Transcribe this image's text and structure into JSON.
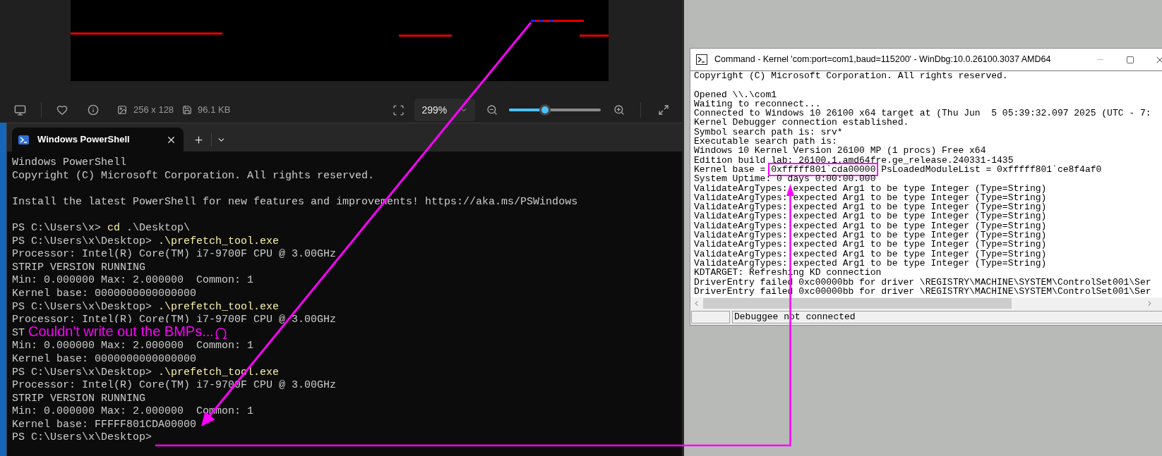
{
  "image_viewer": {
    "toolbar": {
      "dimensions": "256 x 128",
      "file_size": "96.1 KB",
      "zoom": {
        "value": "299%",
        "level": 0.39
      }
    }
  },
  "terminal": {
    "tabs": [
      {
        "title": "Windows PowerShell",
        "selected": true
      }
    ],
    "lines": [
      {
        "kind": "output",
        "text": "Windows PowerShell"
      },
      {
        "kind": "output",
        "text": "Copyright (C) Microsoft Corporation. All rights reserved."
      },
      {
        "kind": "blank"
      },
      {
        "kind": "output",
        "text": "Install the latest PowerShell for new features and improvements! https://aka.ms/PSWindows"
      },
      {
        "kind": "blank"
      },
      {
        "kind": "prompt",
        "prompt": "PS C:\\Users\\x>",
        "command": "cd",
        "args": ".\\Desktop\\"
      },
      {
        "kind": "prompt",
        "prompt": "PS C:\\Users\\x\\Desktop>",
        "command": ".\\prefetch_tool.exe"
      },
      {
        "kind": "output",
        "text": "Processor: Intel(R) Core(TM) i7-9700F CPU @ 3.00GHz"
      },
      {
        "kind": "output",
        "text": "STRIP VERSION RUNNING"
      },
      {
        "kind": "output",
        "text": "Min: 0.000000 Max: 2.000000  Common: 1"
      },
      {
        "kind": "output",
        "text": "Kernel base: 0000000000000000"
      },
      {
        "kind": "prompt",
        "prompt": "PS C:\\Users\\x\\Desktop>",
        "command": ".\\prefetch_tool.exe"
      },
      {
        "kind": "output",
        "text": "Processor: Intel(R) Core(TM) i7-9700F CPU @ 3.00GHz"
      },
      {
        "kind": "output",
        "text": "ST"
      },
      {
        "kind": "output",
        "text": "Min: 0.000000 Max: 2.000000  Common: 1"
      },
      {
        "kind": "output",
        "text": "Kernel base: 0000000000000000"
      },
      {
        "kind": "prompt",
        "prompt": "PS C:\\Users\\x\\Desktop>",
        "command": ".\\prefetch_tool.exe"
      },
      {
        "kind": "output",
        "text": "Processor: Intel(R) Core(TM) i7-9700F CPU @ 3.00GHz"
      },
      {
        "kind": "output",
        "text": "STRIP VERSION RUNNING"
      },
      {
        "kind": "output",
        "text": "Min: 0.000000 Max: 2.000000  Common: 1"
      },
      {
        "kind": "output",
        "text": "Kernel base: FFFFF801CDA00000"
      },
      {
        "kind": "prompt",
        "prompt": "PS C:\\Users\\x\\Desktop>"
      }
    ]
  },
  "debugger": {
    "title": "Command - Kernel 'com:port=com1,baud=115200' - WinDbg:10.0.26100.3037 AMD64",
    "lines": [
      {
        "kind": "output",
        "text": "Copyright (C) Microsoft Corporation. All rights reserved."
      },
      {
        "kind": "blank"
      },
      {
        "kind": "output",
        "text": "Opened \\\\.\\com1"
      },
      {
        "kind": "output",
        "text": "Waiting to reconnect..."
      },
      {
        "kind": "output",
        "text": "Connected to Windows 10 26100 x64 target at (Thu Jun  5 05:39:32.097 2025 (UTC - 7:"
      },
      {
        "kind": "output",
        "text": "Kernel Debugger connection established."
      },
      {
        "kind": "output",
        "text": "Symbol search path is: srv*"
      },
      {
        "kind": "output",
        "text": "Executable search path is:"
      },
      {
        "kind": "output",
        "text": "Windows 10 Kernel Version 26100 MP (1 procs) Free x64"
      },
      {
        "kind": "output",
        "text": "Edition build lab: 26100.1.amd64fre.ge_release.240331-1435"
      },
      {
        "kind": "highlighted",
        "before": "Kernel base = ",
        "highlight": "0xfffff801`cda00000",
        "after": " PsLoadedModuleList = 0xfffff801`ce8f4af0"
      },
      {
        "kind": "output",
        "text": "System Uptime: 0 days 0:00:00.000"
      },
      {
        "kind": "output",
        "text": "ValidateArgTypes: expected Arg1 to be type Integer (Type=String)"
      },
      {
        "kind": "output",
        "text": "ValidateArgTypes: expected Arg1 to be type Integer (Type=String)"
      },
      {
        "kind": "output",
        "text": "ValidateArgTypes: expected Arg1 to be type Integer (Type=String)"
      },
      {
        "kind": "output",
        "text": "ValidateArgTypes: expected Arg1 to be type Integer (Type=String)"
      },
      {
        "kind": "output",
        "text": "ValidateArgTypes: expected Arg1 to be type Integer (Type=String)"
      },
      {
        "kind": "output",
        "text": "ValidateArgTypes: expected Arg1 to be type Integer (Type=String)"
      },
      {
        "kind": "output",
        "text": "ValidateArgTypes: expected Arg1 to be type Integer (Type=String)"
      },
      {
        "kind": "output",
        "text": "ValidateArgTypes: expected Arg1 to be type Integer (Type=String)"
      },
      {
        "kind": "output",
        "text": "ValidateArgTypes: expected Arg1 to be type Integer (Type=String)"
      },
      {
        "kind": "output",
        "text": "KDTARGET: Refreshing KD connection"
      },
      {
        "kind": "output",
        "text": "DriverEntry failed 0xc00000bb for driver \\REGISTRY\\MACHINE\\SYSTEM\\ControlSet001\\Ser"
      },
      {
        "kind": "output",
        "text": "DriverEntry failed 0xc00000bb for driver \\REGISTRY\\MACHINE\\SYSTEM\\ControlSet001\\Ser"
      }
    ],
    "status": "Debuggee not connected"
  },
  "annotation": {
    "caption": "Couldn't write out the BMPs..."
  }
}
